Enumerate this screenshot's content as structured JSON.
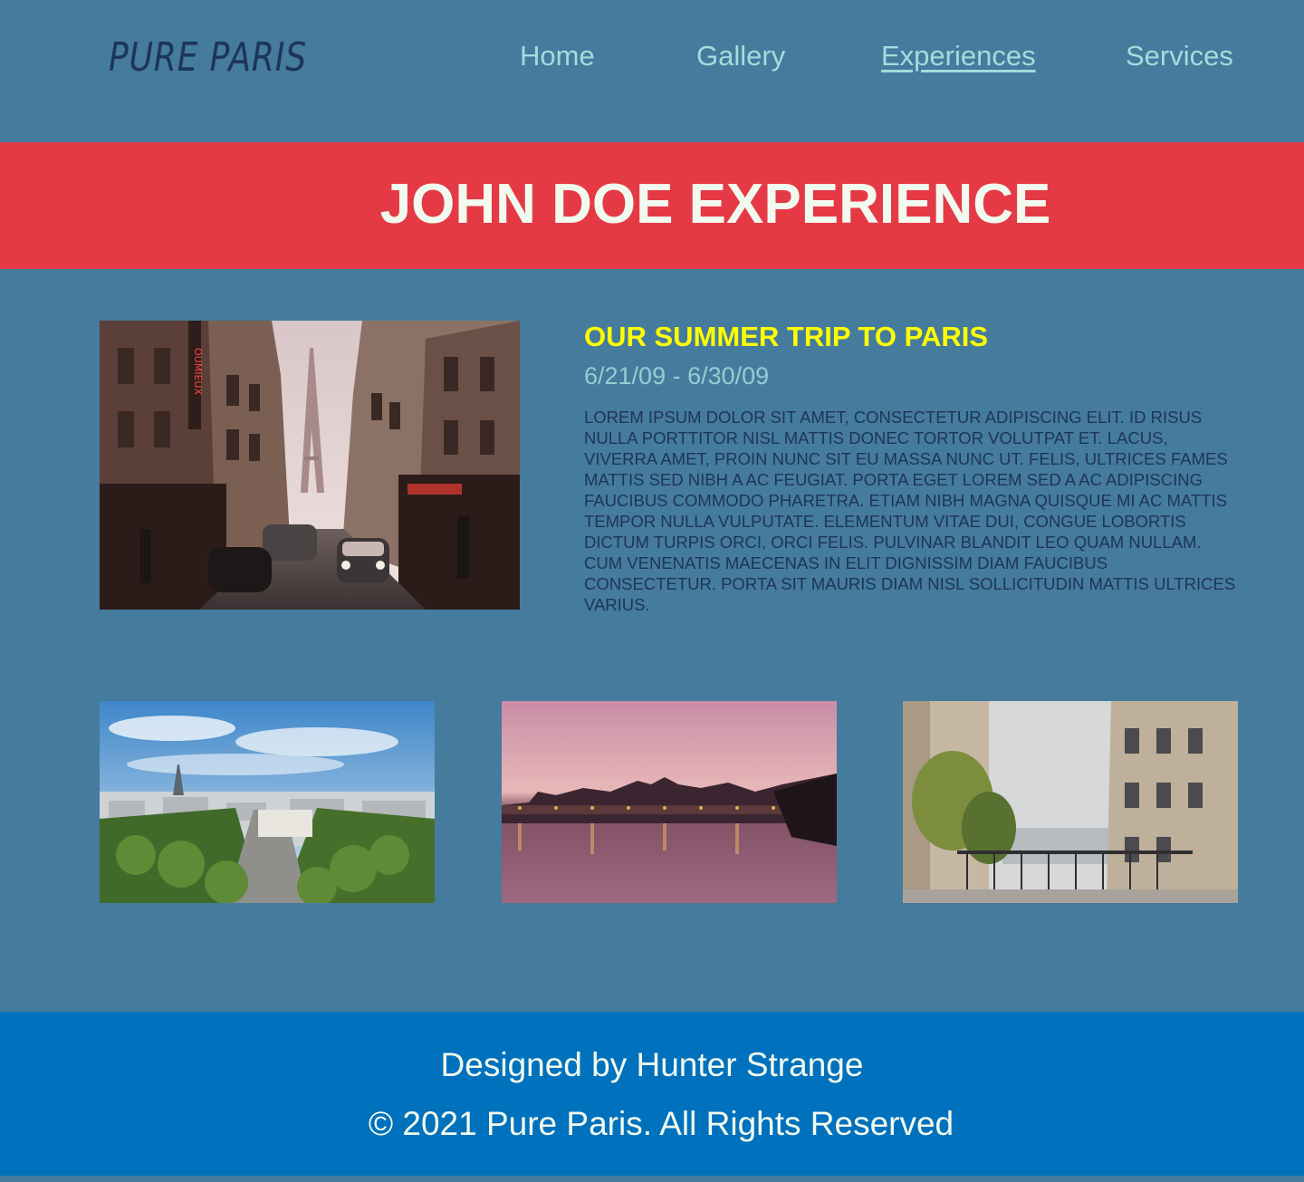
{
  "header": {
    "logo": "PURE PARIS",
    "nav": [
      {
        "label": "Home",
        "active": false
      },
      {
        "label": "Gallery",
        "active": false
      },
      {
        "label": "Experiences",
        "active": true
      },
      {
        "label": "Services",
        "active": false
      }
    ]
  },
  "banner": {
    "title": "JOHN DOE EXPERIENCE"
  },
  "feature": {
    "image_icon": "paris-street-photo",
    "title": "OUR SUMMER TRIP TO PARIS",
    "dates": "6/21/09 - 6/30/09",
    "body": "Lorem ipsum dolor sit amet, consectetur adipiscing elit. Id risus nulla porttitor nisl mattis donec tortor volutpat et. Lacus, viverra amet, proin nunc sit eu massa nunc ut. Felis, ultrices fames mattis sed nibh a ac feugiat. Porta eget lorem sed a ac adipiscing faucibus commodo pharetra. Etiam nibh magna quisque mi ac mattis tempor nulla vulputate. Elementum vitae dui, congue lobortis dictum turpis orci, orci felis. Pulvinar blandit leo quam nullam. Cum venenatis maecenas in elit dignissim diam faucibus consectetur. Porta sit mauris diam nisl sollicitudin mattis ultrices varius."
  },
  "gallery": [
    {
      "icon": "paris-skyline-photo"
    },
    {
      "icon": "seine-sunset-photo"
    },
    {
      "icon": "montmartre-balcony-photo"
    }
  ],
  "footer": {
    "credit": "Designed by Hunter Strange",
    "copyright": "© 2021 Pure Paris. All Rights Reserved"
  },
  "colors": {
    "background": "#457b9d",
    "banner": "#e63946",
    "footer": "#0071bd",
    "nav": "#a8dadc",
    "logo": "#1d3557",
    "accent_title": "#ffff00",
    "light_text": "#f1faee"
  }
}
